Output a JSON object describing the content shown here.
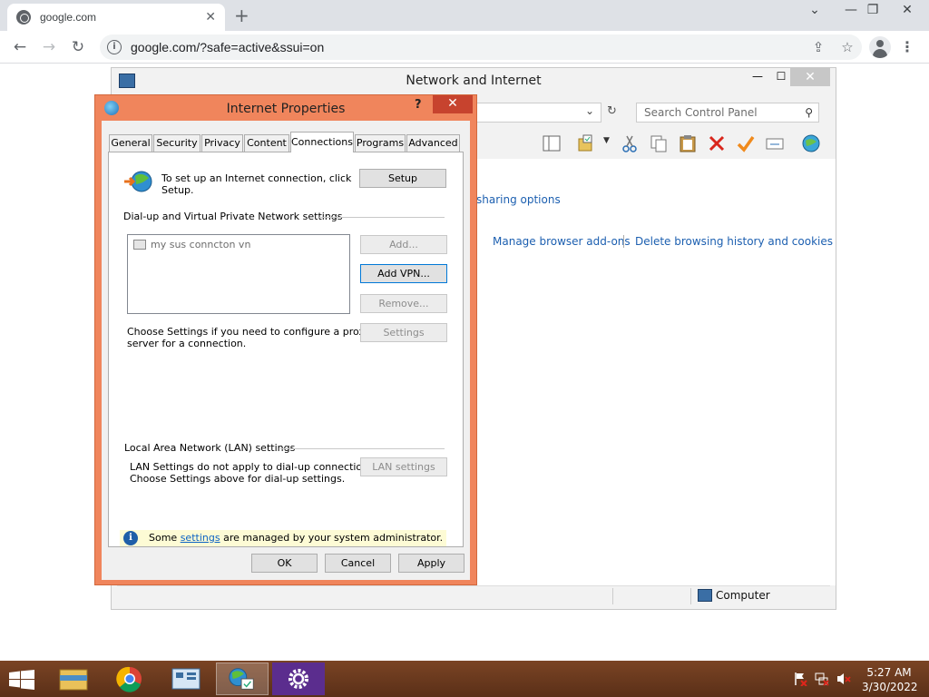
{
  "browser": {
    "tab_title": "google.com",
    "tab_close": "✕",
    "new_tab": "+",
    "url": "google.com/?safe=active&ssui=on",
    "window_controls": {
      "minimize": "—",
      "restore": "❐",
      "close": "✕"
    },
    "chevron": "⌄"
  },
  "control_panel": {
    "title": "Network and Internet",
    "search_placeholder": "Search Control Panel",
    "links": {
      "sharing_options": "sharing options",
      "manage_addons": "Manage browser add-ons",
      "delete_history": "Delete browsing history and cookies"
    },
    "status_computer": "Computer"
  },
  "dialog": {
    "title": "Internet Properties",
    "help": "?",
    "close": "✕",
    "tabs": [
      "General",
      "Security",
      "Privacy",
      "Content",
      "Connections",
      "Programs",
      "Advanced"
    ],
    "active_tab": "Connections",
    "setup_text_1": "To set up an Internet connection, click",
    "setup_text_2": "Setup.",
    "setup_button": "Setup",
    "dialup_header": "Dial-up and Virtual Private Network settings",
    "connections": [
      "my sus conncton vn"
    ],
    "add_button": "Add...",
    "add_vpn_button": "Add VPN...",
    "remove_button": "Remove...",
    "settings_button": "Settings",
    "proxy_text_1": "Choose Settings if you need to configure a proxy",
    "proxy_text_2": "server for a connection.",
    "lan_header": "Local Area Network (LAN) settings",
    "lan_text_1": "LAN Settings do not apply to dial-up connections.",
    "lan_text_2": "Choose Settings above for dial-up settings.",
    "lan_button": "LAN settings",
    "info_prefix": "Some ",
    "info_link": "settings",
    "info_suffix": " are managed by your system administrator.",
    "ok_button": "OK",
    "cancel_button": "Cancel",
    "apply_button": "Apply"
  },
  "taskbar": {
    "time": "5:27 AM",
    "date": "3/30/2022"
  },
  "colors": {
    "dialog_frame": "#f0855c",
    "close_red": "#c7432e",
    "link_blue": "#1c5fb0",
    "taskbar": "#6b3a1f"
  }
}
